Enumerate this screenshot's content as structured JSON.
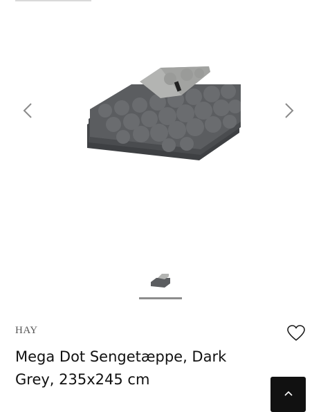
{
  "gallery": {
    "main_image_alt": "Mega Dot Sengetæppe, Dark Grey",
    "prev_icon": "chevron-left-icon",
    "next_icon": "chevron-right-icon",
    "thumbnail_alt": "Mega Dot Sengetæppe thumbnail"
  },
  "product": {
    "brand": "HAY",
    "title": "Mega Dot Sengetæppe, Dark Grey, 235x245 cm"
  },
  "actions": {
    "wishlist_icon": "heart-icon",
    "scroll_top_icon": "chevron-up-icon"
  },
  "colors": {
    "blanket_dark": "#5b5d60",
    "blanket_light": "#a9aaa8",
    "accent_dark": "#111111"
  }
}
